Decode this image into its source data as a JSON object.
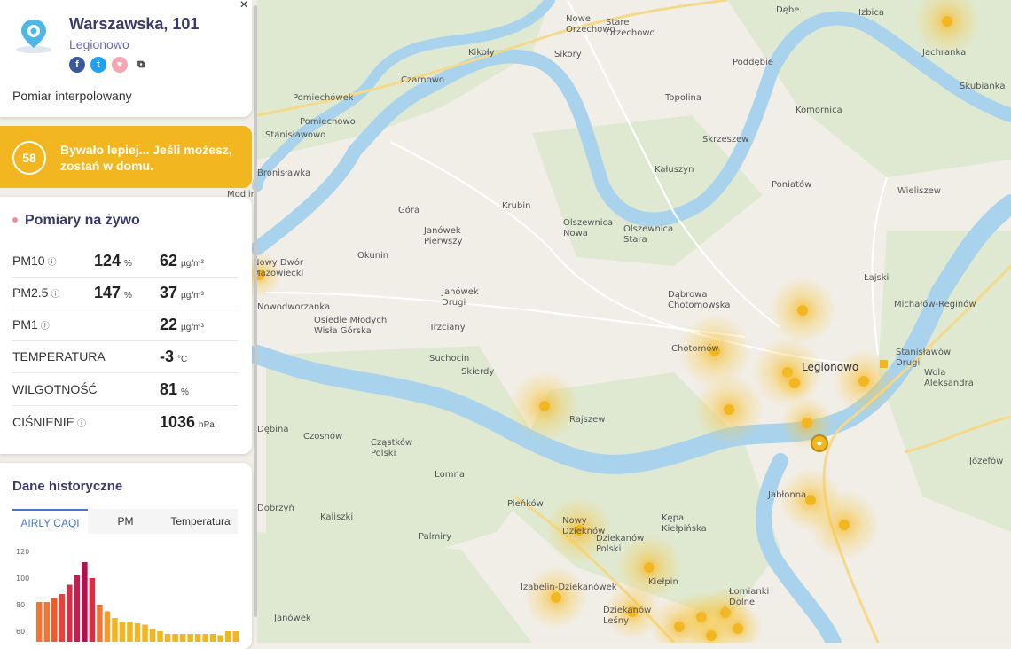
{
  "location": {
    "title": "Warszawska, 101",
    "subtitle": "Legionowo",
    "note": "Pomiar interpolowany",
    "close": "×",
    "share": [
      {
        "icon": "facebook-icon",
        "glyph": "f",
        "color": "#3b5998"
      },
      {
        "icon": "twitter-icon",
        "glyph": "t",
        "color": "#1da1f2"
      },
      {
        "icon": "heart-icon",
        "glyph": "♥",
        "color": "#f4a6b3"
      },
      {
        "icon": "copy-icon",
        "glyph": "⧉",
        "color": "#222222"
      }
    ]
  },
  "caqi": {
    "value": "58",
    "message": "Bywało lepiej... Jeśli możesz, zostań w domu.",
    "color": "#f2b620"
  },
  "live": {
    "title": "Pomiary na żywo",
    "rows": [
      {
        "label": "PM10",
        "help": "?",
        "pct": "124",
        "pct_unit": "%",
        "value": "62",
        "unit": "µg/m³"
      },
      {
        "label": "PM2.5",
        "help": "?",
        "pct": "147",
        "pct_unit": "%",
        "value": "37",
        "unit": "µg/m³"
      },
      {
        "label": "PM1",
        "help": "?",
        "pct": "",
        "pct_unit": "",
        "value": "22",
        "unit": "µg/m³"
      },
      {
        "label": "TEMPERATURA",
        "help": "",
        "pct": "",
        "pct_unit": "",
        "value": "-3",
        "unit": "°C"
      },
      {
        "label": "WILGOTNOŚĆ",
        "help": "",
        "pct": "",
        "pct_unit": "",
        "value": "81",
        "unit": "%"
      },
      {
        "label": "CIŚNIENIE",
        "help": "?",
        "pct": "",
        "pct_unit": "",
        "value": "1036",
        "unit": "hPa"
      }
    ]
  },
  "history": {
    "title": "Dane historyczne",
    "tabs": [
      "AIRLY CAQI",
      "PM",
      "Temperatura"
    ],
    "active_tab": 0
  },
  "chart_data": {
    "type": "bar",
    "yticks": [
      120,
      100,
      80,
      60
    ],
    "ylim": [
      52,
      124
    ],
    "values": [
      82,
      82,
      85,
      88,
      95,
      102,
      112,
      100,
      80,
      75,
      70,
      67,
      67,
      66,
      65,
      62,
      60,
      58,
      58,
      58,
      58,
      58,
      58,
      58,
      57,
      60,
      60
    ],
    "colors": [
      "#f27535",
      "#f27535",
      "#ef5a2b",
      "#e8403a",
      "#d62f45",
      "#c31e4d",
      "#b0124e",
      "#d62f45",
      "#f27535",
      "#f29b2a",
      "#f2b620",
      "#f2b620",
      "#f2b620",
      "#f2b620",
      "#f2b620",
      "#f2b620",
      "#f2b620",
      "#f2b620",
      "#f2b620",
      "#f2b620",
      "#f2b620",
      "#f2b620",
      "#f2b620",
      "#f2b620",
      "#f2b620",
      "#f2b620",
      "#f2b620"
    ]
  },
  "map": {
    "labels": [
      "Dębe",
      "Izbica",
      "Jachranka",
      "Nowe Orzechowo",
      "Stare Orzechowo",
      "Kikoły",
      "Sikory",
      "Poddębie",
      "Skubianka",
      "Czarnowo",
      "Pomiechówek",
      "Topolina",
      "Komornica",
      "Pomiechowo",
      "Stanisławowo",
      "Skrzeszew",
      "Kałuszyn",
      "Bronisławka",
      "Modlin",
      "Poniatów",
      "Wieliszew",
      "Góra",
      "Krubin",
      "Janówek Pierwszy",
      "Olszewnica Nowa",
      "Olszewnica Stara",
      "Okunin",
      "Nowy Dwór Mazowiecki",
      "Janówek Drugi",
      "Dąbrowa Chotomowska",
      "Łajski",
      "Nowodworzanka",
      "Osiedle Młodych Wisła Górska",
      "Trzciany",
      "Chotomów",
      "Michałów-Reginów",
      "Suchocin",
      "Skierdy",
      "Legionowo",
      "Stanisławów Drugi",
      "Wola Aleksandra",
      "Rajszew",
      "Dębina",
      "Czosnów",
      "Cząstków Polski",
      "Łomna",
      "Jabłonna",
      "Józefów",
      "Dobrzyń",
      "Kaliszki",
      "Pieńków",
      "Nowy Dzieknów",
      "Dziekanów Polski",
      "Kępa Kiełpińska",
      "Palmiry",
      "Kiełpin",
      "Izabelin-Dziekanówek",
      "Łomianki Dolne",
      "Dziekanów Leśny",
      "Janówek"
    ]
  }
}
